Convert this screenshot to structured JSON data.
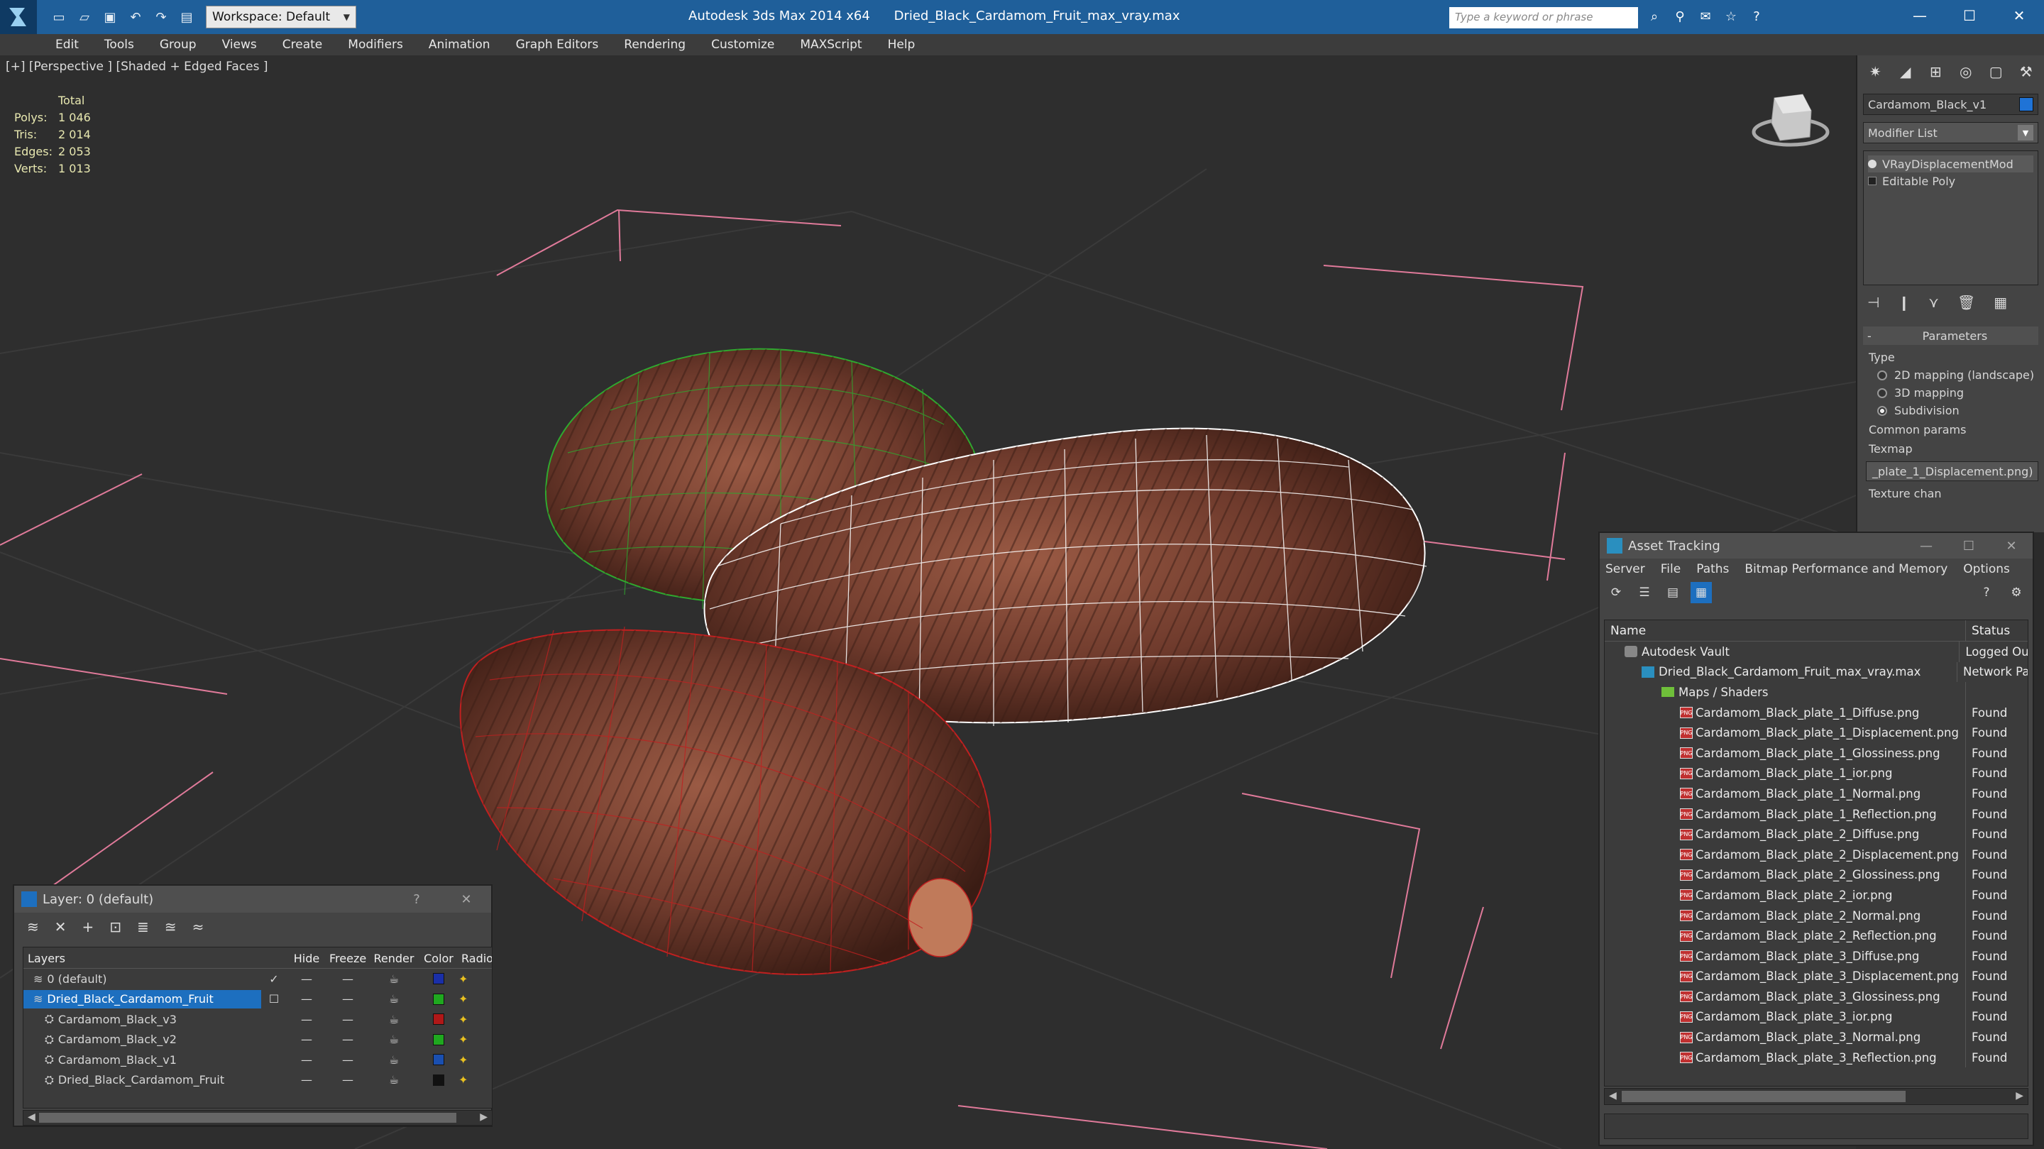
{
  "titlebar": {
    "app_name": "Autodesk 3ds Max  2014 x64",
    "file_name": "Dried_Black_Cardamom_Fruit_max_vray.max",
    "workspace_label": "Workspace: Default",
    "search_placeholder": "Type a keyword or phrase"
  },
  "menu": [
    "Edit",
    "Tools",
    "Group",
    "Views",
    "Create",
    "Modifiers",
    "Animation",
    "Graph Editors",
    "Rendering",
    "Customize",
    "MAXScript",
    "Help"
  ],
  "viewport": {
    "label": "[+] [Perspective ] [Shaded + Edged Faces ]",
    "stats_header": "Total",
    "stats": [
      {
        "k": "Polys:",
        "v": "1 046"
      },
      {
        "k": "Tris:",
        "v": "2 014"
      },
      {
        "k": "Edges:",
        "v": "2 053"
      },
      {
        "k": "Verts:",
        "v": "1 013"
      }
    ]
  },
  "command_panel": {
    "object_name": "Cardamom_Black_v1",
    "modifier_list": "Modifier List",
    "stack": [
      "VRayDisplacementMod",
      "Editable Poly"
    ],
    "rollout": "Parameters",
    "type_label": "Type",
    "type_options": [
      "2D mapping (landscape)",
      "3D mapping",
      "Subdivision"
    ],
    "common_params": "Common params",
    "texmap_label": "Texmap",
    "texmap_value": "_plate_1_Displacement.png)",
    "texture_chan": "Texture chan"
  },
  "asset_tracking": {
    "title": "Asset Tracking",
    "menu": [
      "Server",
      "File",
      "Paths",
      "Bitmap Performance and Memory",
      "Options"
    ],
    "col_name": "Name",
    "col_status": "Status",
    "rows": [
      {
        "name": "Autodesk Vault",
        "status": "Logged Ou",
        "type": "vault"
      },
      {
        "name": "Dried_Black_Cardamom_Fruit_max_vray.max",
        "status": "Network Pa",
        "type": "max"
      },
      {
        "name": "Maps / Shaders",
        "status": "",
        "type": "folder"
      },
      {
        "name": "Cardamom_Black_plate_1_Diffuse.png",
        "status": "Found",
        "type": "png"
      },
      {
        "name": "Cardamom_Black_plate_1_Displacement.png",
        "status": "Found",
        "type": "png"
      },
      {
        "name": "Cardamom_Black_plate_1_Glossiness.png",
        "status": "Found",
        "type": "png"
      },
      {
        "name": "Cardamom_Black_plate_1_ior.png",
        "status": "Found",
        "type": "png"
      },
      {
        "name": "Cardamom_Black_plate_1_Normal.png",
        "status": "Found",
        "type": "png"
      },
      {
        "name": "Cardamom_Black_plate_1_Reflection.png",
        "status": "Found",
        "type": "png"
      },
      {
        "name": "Cardamom_Black_plate_2_Diffuse.png",
        "status": "Found",
        "type": "png"
      },
      {
        "name": "Cardamom_Black_plate_2_Displacement.png",
        "status": "Found",
        "type": "png"
      },
      {
        "name": "Cardamom_Black_plate_2_Glossiness.png",
        "status": "Found",
        "type": "png"
      },
      {
        "name": "Cardamom_Black_plate_2_ior.png",
        "status": "Found",
        "type": "png"
      },
      {
        "name": "Cardamom_Black_plate_2_Normal.png",
        "status": "Found",
        "type": "png"
      },
      {
        "name": "Cardamom_Black_plate_2_Reflection.png",
        "status": "Found",
        "type": "png"
      },
      {
        "name": "Cardamom_Black_plate_3_Diffuse.png",
        "status": "Found",
        "type": "png"
      },
      {
        "name": "Cardamom_Black_plate_3_Displacement.png",
        "status": "Found",
        "type": "png"
      },
      {
        "name": "Cardamom_Black_plate_3_Glossiness.png",
        "status": "Found",
        "type": "png"
      },
      {
        "name": "Cardamom_Black_plate_3_ior.png",
        "status": "Found",
        "type": "png"
      },
      {
        "name": "Cardamom_Black_plate_3_Normal.png",
        "status": "Found",
        "type": "png"
      },
      {
        "name": "Cardamom_Black_plate_3_Reflection.png",
        "status": "Found",
        "type": "png"
      }
    ]
  },
  "layers": {
    "title": "Layer: 0 (default)",
    "cols": [
      "Layers",
      "Hide",
      "Freeze",
      "Render",
      "Color",
      "Radio"
    ],
    "rows": [
      {
        "name": "0 (default)",
        "color": "#1a2fa8",
        "check": "✓",
        "selected": false,
        "child": false
      },
      {
        "name": "Dried_Black_Cardamom_Fruit",
        "color": "#1fa81f",
        "check": "☐",
        "selected": true,
        "child": false
      },
      {
        "name": "Cardamom_Black_v3",
        "color": "#b01818",
        "check": "",
        "selected": false,
        "child": true
      },
      {
        "name": "Cardamom_Black_v2",
        "color": "#1fa81f",
        "check": "",
        "selected": false,
        "child": true
      },
      {
        "name": "Cardamom_Black_v1",
        "color": "#1a4fb0",
        "check": "",
        "selected": false,
        "child": true
      },
      {
        "name": "Dried_Black_Cardamom_Fruit",
        "color": "#111111",
        "check": "",
        "selected": false,
        "child": true
      }
    ]
  }
}
